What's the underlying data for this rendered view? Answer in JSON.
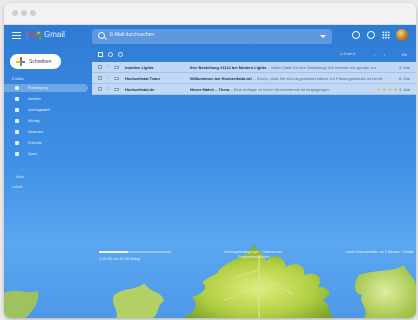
{
  "app": {
    "name": "Gmail",
    "search": {
      "placeholder": "E-Mail durchsuchen"
    },
    "compose_label": "Schreiben"
  },
  "sidebar": {
    "section_label": "E-Mails",
    "items": [
      {
        "label": "Posteingang",
        "count": "",
        "active": true,
        "icon": "inbox-icon"
      },
      {
        "label": "Markiert",
        "count": "",
        "active": false,
        "icon": "star-icon"
      },
      {
        "label": "Zurückgestellt",
        "count": "",
        "active": false,
        "icon": "clock-icon"
      },
      {
        "label": "Wichtig",
        "count": "",
        "active": false,
        "icon": "important-icon"
      },
      {
        "label": "Gesendet",
        "count": "",
        "active": false,
        "icon": "send-icon"
      },
      {
        "label": "Entwürfe",
        "count": "",
        "active": false,
        "icon": "draft-icon"
      },
      {
        "label": "Spam",
        "count": "",
        "active": false,
        "icon": "spam-icon"
      }
    ],
    "more_label": "Mehr",
    "labels_heading": "Labels"
  },
  "toolbar": {
    "page_range": "1–3 von 3",
    "lang": "De"
  },
  "emails": [
    {
      "sender": "Intuitive Lights",
      "subject": "Ihre Bestellung #1114 bei Modern Lights",
      "snippet": "– Vielen Dank für Ihre Bestellung! Wir bereiten sie gerade vor.",
      "date": "9. Mai",
      "tags": ""
    },
    {
      "sender": "Hochzeitstal Team",
      "subject": "Willkommen bei Hochzeitstal.de!",
      "snippet": "– Schön, dass Sie sich angemeldet haben. Ihr Planungsbereich ist bereit.",
      "date": "8. Mai",
      "tags": ""
    },
    {
      "sender": "Hochzeitstal.de",
      "subject": "Neuer Match – Thera",
      "snippet": "– Eine Anfrage zu Ihrem Wunschtermin ist eingegangen.",
      "date": "4. Mai",
      "tags": "★ ★ ★ ★"
    }
  ],
  "footer": {
    "storage_text": "0,09 GB von 15 GB belegt",
    "storage_fraction": 0.4,
    "middle": "Nutzungsbedingungen · Datenschutz · Programmrichtlinien",
    "right": "Letzte Kontoaktivität: vor 2 Minuten · Details"
  },
  "colors": {
    "accent": "#1a73e8",
    "background_top": "#2f7bd4",
    "background_bottom": "#4e99e8"
  }
}
